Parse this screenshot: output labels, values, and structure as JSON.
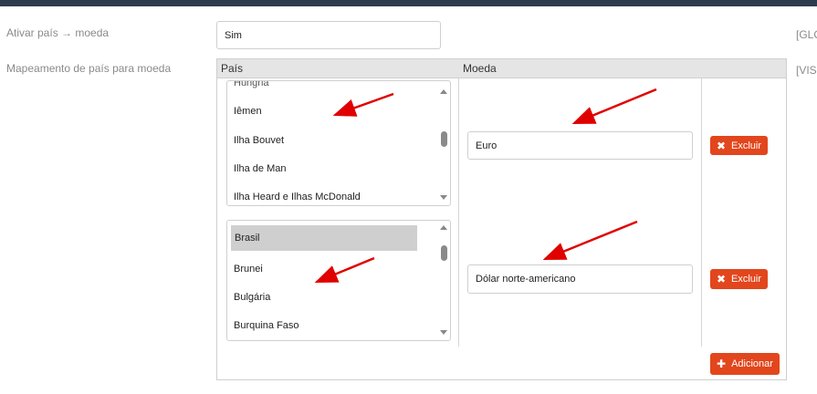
{
  "settings": {
    "activate_label": "Ativar país → moeda",
    "activate_value": "Sim",
    "activate_scope": "[GLO",
    "mapping_label": "Mapeamento de país para moeda",
    "mapping_scope": "[VIS"
  },
  "table": {
    "col_country": "País",
    "col_currency": "Moeda",
    "rows": [
      {
        "countries": [
          "Hungria",
          "Iêmen",
          "Ilha Bouvet",
          "Ilha de Man",
          "Ilha Heard e Ilhas McDonald"
        ],
        "selected": null,
        "currency": "Euro",
        "delete_label": "Excluir"
      },
      {
        "countries": [
          "Brasil",
          "Brunei",
          "Bulgária",
          "Burquina Faso"
        ],
        "selected": "Brasil",
        "currency": "Dólar norte-americano",
        "delete_label": "Excluir"
      }
    ],
    "add_label": "Adicionar"
  },
  "colors": {
    "accent": "#e2461d",
    "header_bg": "#e5e5e5",
    "topbar": "#2d3b4f",
    "arrow": "#e00000"
  },
  "icons": {
    "delete": "times-icon",
    "add": "plus-icon"
  }
}
